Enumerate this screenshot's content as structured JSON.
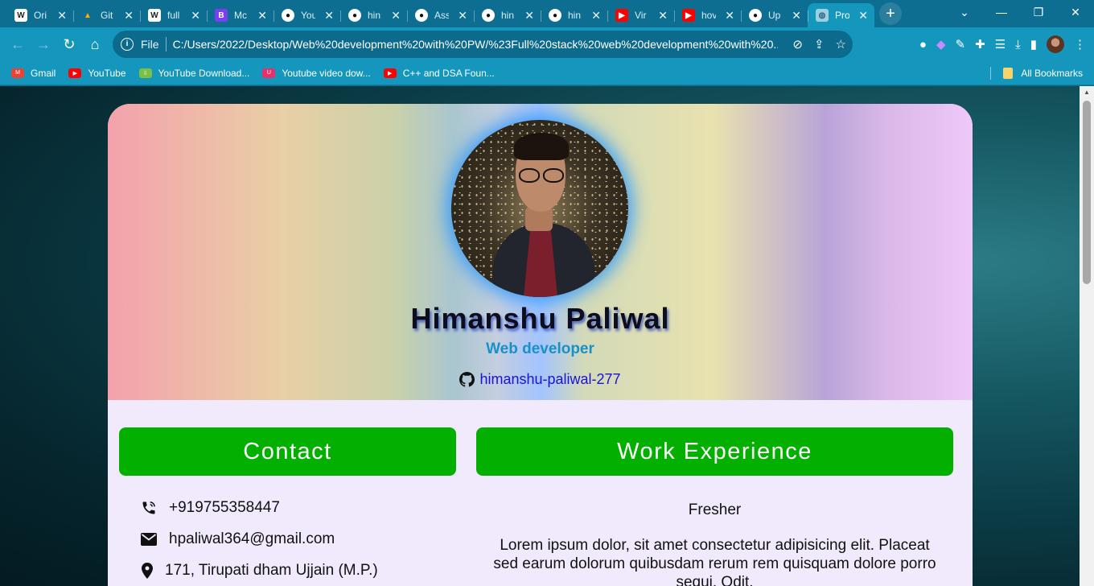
{
  "browser": {
    "tabs": [
      {
        "title": "Ori",
        "icon": "wikipedia-icon",
        "active": false
      },
      {
        "title": "Git",
        "icon": "google-drive-icon",
        "active": false
      },
      {
        "title": "full",
        "icon": "wikipedia-icon",
        "active": false
      },
      {
        "title": "Mc",
        "icon": "bootstrap-icon",
        "active": false
      },
      {
        "title": "You",
        "icon": "github-icon",
        "active": false
      },
      {
        "title": "hin",
        "icon": "github-icon",
        "active": false
      },
      {
        "title": "Ass",
        "icon": "github-icon",
        "active": false
      },
      {
        "title": "hin",
        "icon": "github-icon",
        "active": false
      },
      {
        "title": "hin",
        "icon": "github-icon",
        "active": false
      },
      {
        "title": "Vir",
        "icon": "youtube-icon",
        "active": false
      },
      {
        "title": "hov",
        "icon": "youtube-icon",
        "active": false
      },
      {
        "title": "Up",
        "icon": "github-icon",
        "active": false
      },
      {
        "title": "Pro",
        "icon": "globe-icon",
        "active": true
      }
    ],
    "address": {
      "scheme_label": "File",
      "url": "C:/Users/2022/Desktop/Web%20development%20with%20PW/%23Full%20stack%20web%20development%20with%20..."
    },
    "bookmarks": [
      {
        "label": "Gmail",
        "icon": "gmail-icon",
        "color": "#ea4335"
      },
      {
        "label": "YouTube",
        "icon": "youtube-icon",
        "color": "#ff0000"
      },
      {
        "label": "YouTube Download...",
        "icon": "download-icon",
        "color": "#7bc043"
      },
      {
        "label": "Youtube video dow...",
        "icon": "u-icon",
        "color": "#e5326c"
      },
      {
        "label": "C++ and DSA Foun...",
        "icon": "youtube-icon",
        "color": "#ff0000"
      }
    ],
    "all_bookmarks": "All Bookmarks"
  },
  "profile": {
    "name": "Himanshu Paliwal",
    "role": "Web developer",
    "github_handle": "himanshu-paliwal-277"
  },
  "sections": {
    "contact_title": "Contact",
    "work_title": "Work Experience"
  },
  "contact": {
    "phone": "+919755358447",
    "email": "hpaliwal364@gmail.com",
    "address": "171, Tirupati dham Ujjain (M.P.)"
  },
  "work": {
    "level": "Fresher",
    "description": "Lorem ipsum dolor, sit amet consectetur adipisicing elit. Placeat sed earum dolorum quibusdam rerum rem quisquam dolore porro sequi. Odit."
  },
  "colors": {
    "section_button": "#03b000",
    "role_text": "#1890c8",
    "link_text": "#1a12d6",
    "card_body": "#f1e9fc"
  }
}
